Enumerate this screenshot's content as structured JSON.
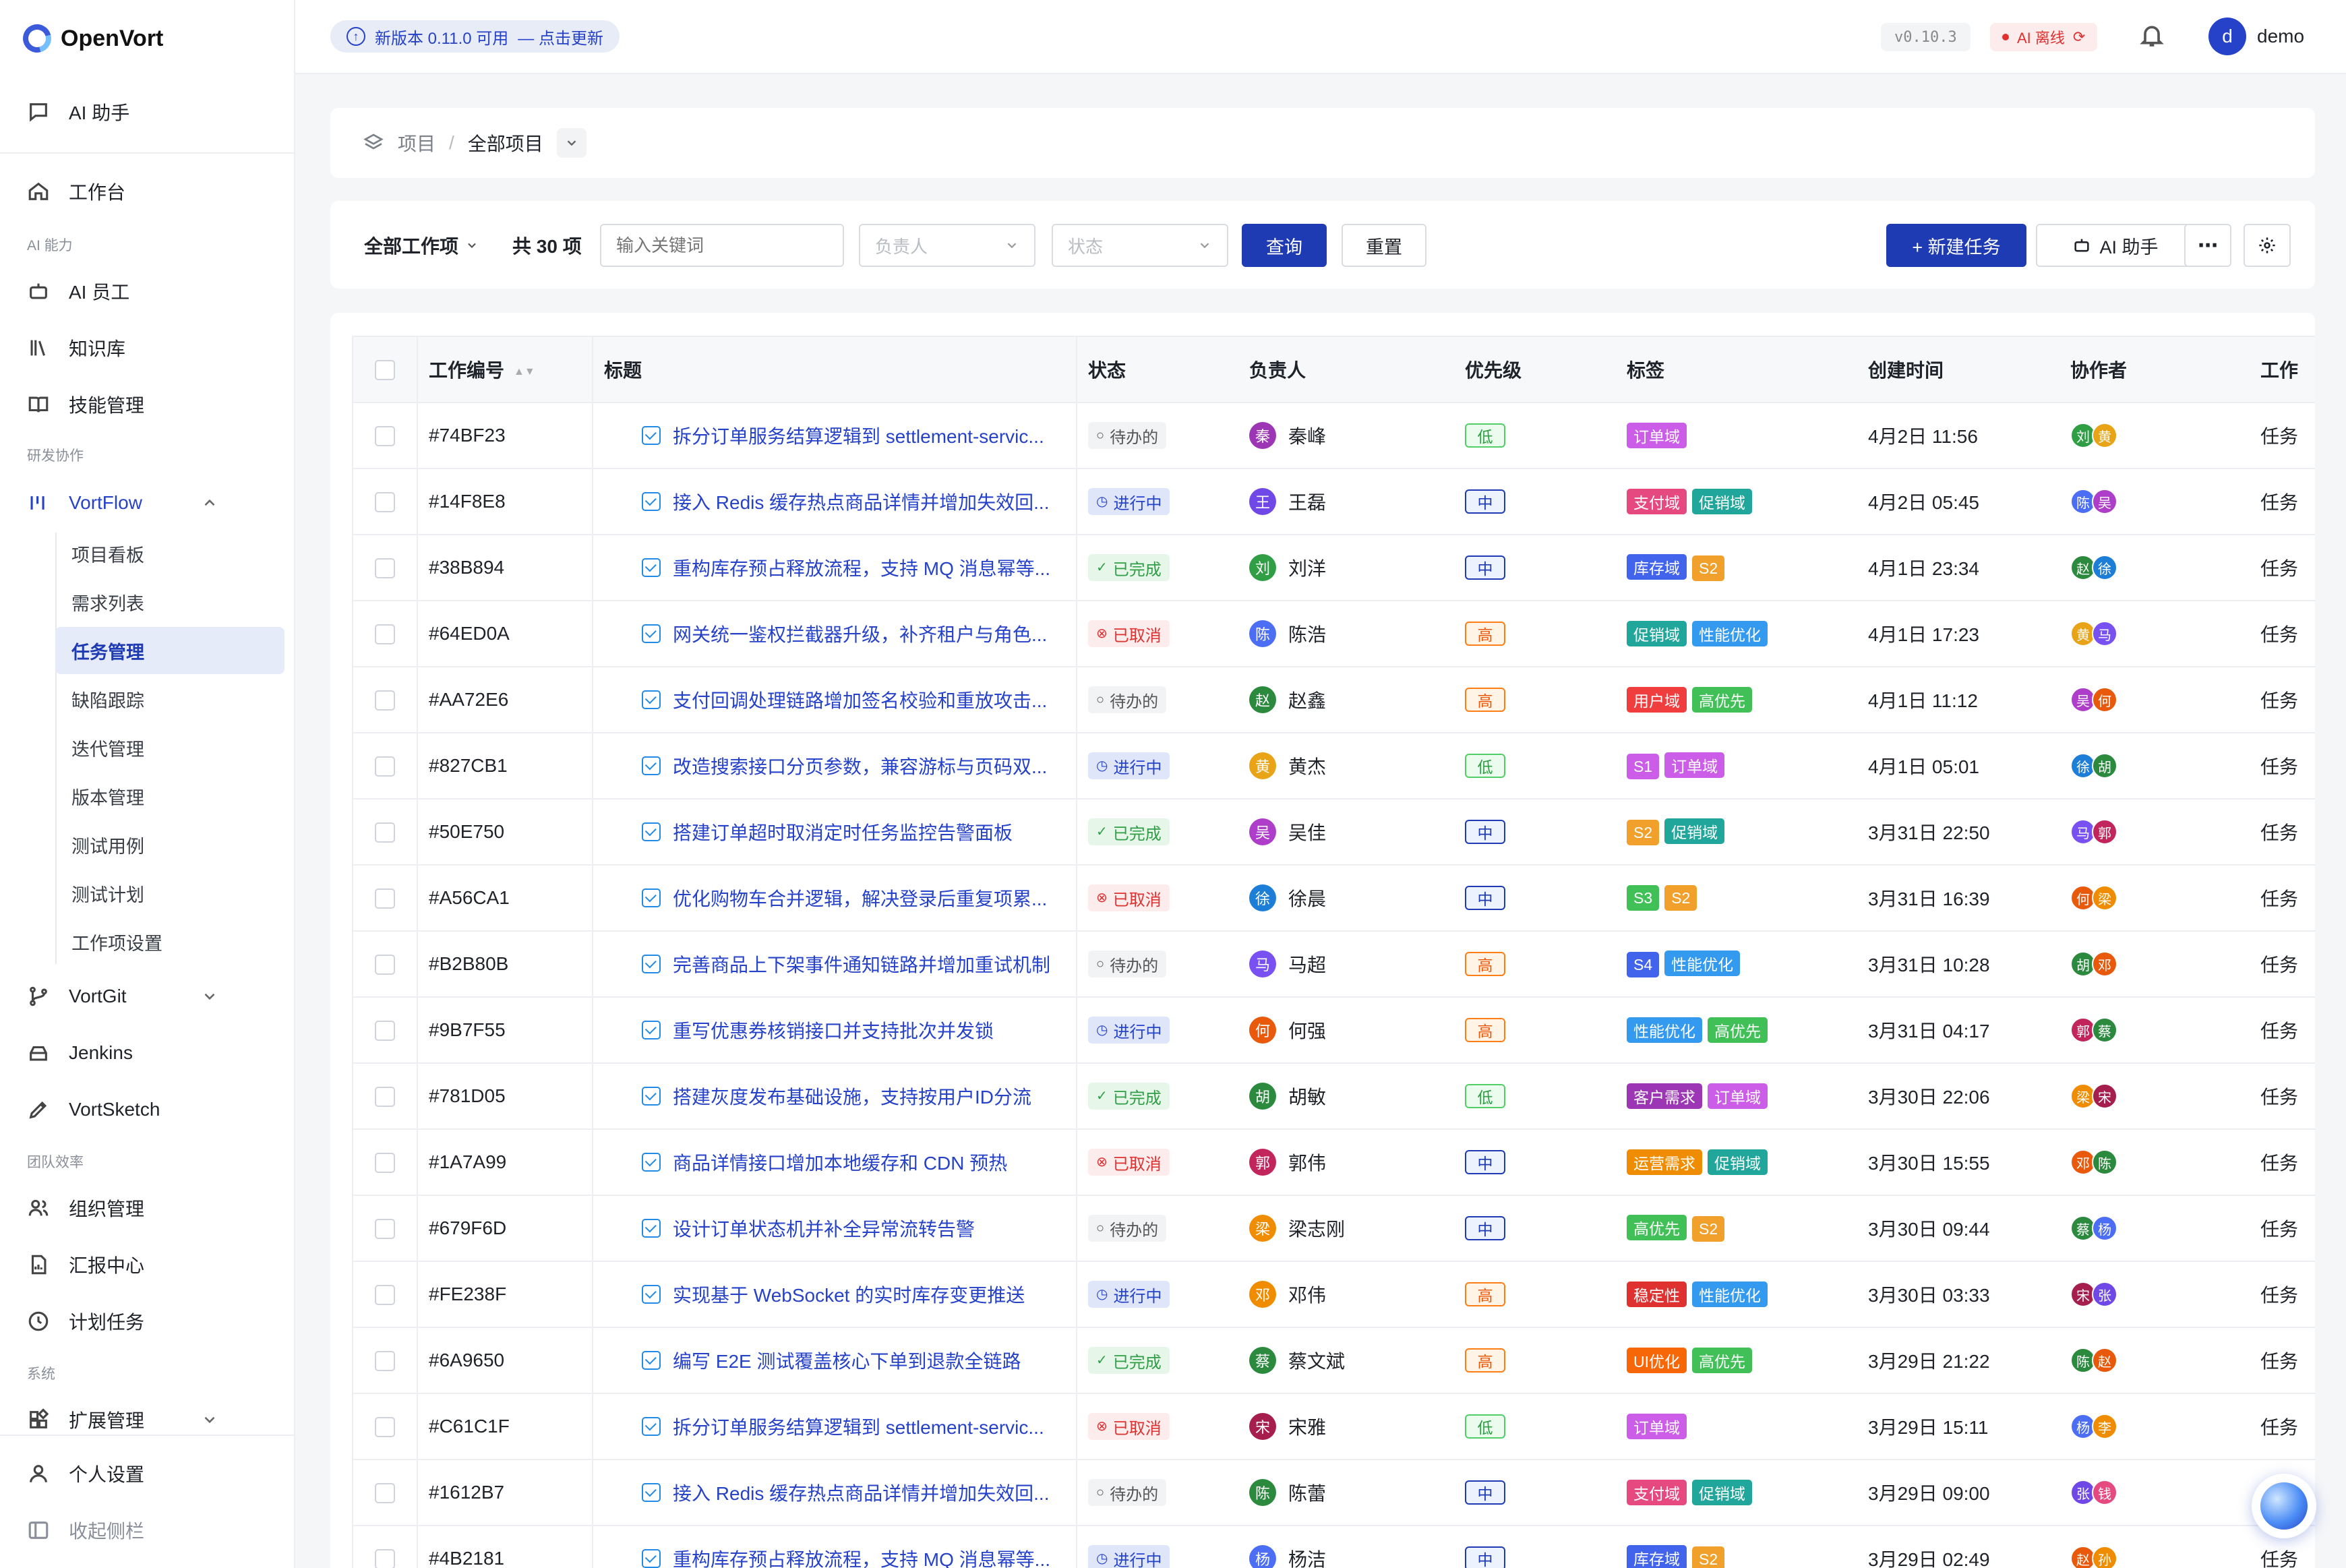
{
  "app": {
    "name": "OpenVort"
  },
  "sidebar": {
    "ai_assistant": "AI 助手",
    "workbench": "工作台",
    "section_ai": "AI 能力",
    "ai_staff": "AI 员工",
    "knowledge": "知识库",
    "skills": "技能管理",
    "section_dev": "研发协作",
    "vortflow": "VortFlow",
    "vortflow_children": [
      "项目看板",
      "需求列表",
      "任务管理",
      "缺陷跟踪",
      "迭代管理",
      "版本管理",
      "测试用例",
      "测试计划",
      "工作项设置"
    ],
    "selected_child": "任务管理",
    "vortgit": "VortGit",
    "jenkins": "Jenkins",
    "vortsketch": "VortSketch",
    "section_team": "团队效率",
    "org": "组织管理",
    "reports": "汇报中心",
    "scheduled": "计划任务",
    "section_system": "系统",
    "extensions": "扩展管理",
    "personal": "个人设置",
    "collapse": "收起侧栏"
  },
  "topbar": {
    "update_text": "新版本 0.11.0 可用",
    "update_link": "— 点击更新",
    "version": "v0.10.3",
    "ai_status": "AI 离线",
    "user_initial": "d",
    "user_name": "demo"
  },
  "breadcrumb": {
    "root": "项目",
    "current": "全部项目"
  },
  "filters": {
    "scope": "全部工作项",
    "count": "共 30 项",
    "keyword_placeholder": "输入关键词",
    "owner_placeholder": "负责人",
    "status_placeholder": "状态",
    "query": "查询",
    "reset": "重置",
    "new_task": "+ 新建任务",
    "ai_assistant": "AI 助手"
  },
  "table": {
    "columns": [
      "工作编号",
      "标题",
      "状态",
      "负责人",
      "优先级",
      "标签",
      "创建时间",
      "协作者",
      "工作"
    ],
    "more_cell": "任务",
    "rows": [
      {
        "id": "#74BF23",
        "title": "拆分订单服务结算逻辑到 settlement-servic...",
        "status": "待办的",
        "owner": "秦峰",
        "owner_initial": "秦",
        "owner_color": "#9c36b5",
        "priority": "低",
        "tags": [
          {
            "t": "订单域",
            "c": "#cc5de8"
          }
        ],
        "created": "4月2日 11:56",
        "collab": [
          {
            "i": "刘",
            "c": "#2f9e44"
          },
          {
            "i": "黄",
            "c": "#e8a317"
          }
        ]
      },
      {
        "id": "#14F8E8",
        "title": "接入 Redis 缓存热点商品详情并增加失效回...",
        "status": "进行中",
        "owner": "王磊",
        "owner_initial": "王",
        "owner_color": "#7048e8",
        "priority": "中",
        "tags": [
          {
            "t": "支付域",
            "c": "#e64980"
          },
          {
            "t": "促销域",
            "c": "#20a69a"
          }
        ],
        "created": "4月2日 05:45",
        "collab": [
          {
            "i": "陈",
            "c": "#4c6ef5"
          },
          {
            "i": "吴",
            "c": "#ae3ec9"
          }
        ]
      },
      {
        "id": "#38B894",
        "title": "重构库存预占释放流程，支持 MQ 消息幂等...",
        "status": "已完成",
        "owner": "刘洋",
        "owner_initial": "刘",
        "owner_color": "#2f9e44",
        "priority": "中",
        "tags": [
          {
            "t": "库存域",
            "c": "#4263eb"
          },
          {
            "t": "S2",
            "c": "#f0a02b"
          }
        ],
        "created": "4月1日 23:34",
        "collab": [
          {
            "i": "赵",
            "c": "#2b8a3e"
          },
          {
            "i": "徐",
            "c": "#1c7ed6"
          }
        ]
      },
      {
        "id": "#64ED0A",
        "title": "网关统一鉴权拦截器升级，补齐租户与角色...",
        "status": "已取消",
        "owner": "陈浩",
        "owner_initial": "陈",
        "owner_color": "#4c6ef5",
        "priority": "高",
        "tags": [
          {
            "t": "促销域",
            "c": "#20a69a"
          },
          {
            "t": "性能优化",
            "c": "#339af0"
          }
        ],
        "created": "4月1日 17:23",
        "collab": [
          {
            "i": "黄",
            "c": "#e8a317"
          },
          {
            "i": "马",
            "c": "#7950f2"
          }
        ]
      },
      {
        "id": "#AA72E6",
        "title": "支付回调处理链路增加签名校验和重放攻击...",
        "status": "待办的",
        "owner": "赵鑫",
        "owner_initial": "赵",
        "owner_color": "#2b8a3e",
        "priority": "高",
        "tags": [
          {
            "t": "用户域",
            "c": "#f03e3e"
          },
          {
            "t": "高优先",
            "c": "#40c057"
          }
        ],
        "created": "4月1日 11:12",
        "collab": [
          {
            "i": "吴",
            "c": "#ae3ec9"
          },
          {
            "i": "何",
            "c": "#e8590c"
          }
        ]
      },
      {
        "id": "#827CB1",
        "title": "改造搜索接口分页参数，兼容游标与页码双...",
        "status": "进行中",
        "owner": "黄杰",
        "owner_initial": "黄",
        "owner_color": "#e8a317",
        "priority": "低",
        "tags": [
          {
            "t": "S1",
            "c": "#cc5de8"
          },
          {
            "t": "订单域",
            "c": "#cc5de8"
          }
        ],
        "created": "4月1日 05:01",
        "collab": [
          {
            "i": "徐",
            "c": "#1c7ed6"
          },
          {
            "i": "胡",
            "c": "#2b8a3e"
          }
        ]
      },
      {
        "id": "#50E750",
        "title": "搭建订单超时取消定时任务监控告警面板",
        "status": "已完成",
        "owner": "吴佳",
        "owner_initial": "吴",
        "owner_color": "#ae3ec9",
        "priority": "中",
        "tags": [
          {
            "t": "S2",
            "c": "#f0a02b"
          },
          {
            "t": "促销域",
            "c": "#20a69a"
          }
        ],
        "created": "3月31日 22:50",
        "collab": [
          {
            "i": "马",
            "c": "#7950f2"
          },
          {
            "i": "郭",
            "c": "#c2255c"
          }
        ]
      },
      {
        "id": "#A56CA1",
        "title": "优化购物车合并逻辑，解决登录后重复项累...",
        "status": "已取消",
        "owner": "徐晨",
        "owner_initial": "徐",
        "owner_color": "#1c7ed6",
        "priority": "中",
        "tags": [
          {
            "t": "S3",
            "c": "#40c057"
          },
          {
            "t": "S2",
            "c": "#f0a02b"
          }
        ],
        "created": "3月31日 16:39",
        "collab": [
          {
            "i": "何",
            "c": "#e8590c"
          },
          {
            "i": "梁",
            "c": "#f08c00"
          }
        ]
      },
      {
        "id": "#B2B80B",
        "title": "完善商品上下架事件通知链路并增加重试机制",
        "status": "待办的",
        "owner": "马超",
        "owner_initial": "马",
        "owner_color": "#7950f2",
        "priority": "高",
        "tags": [
          {
            "t": "S4",
            "c": "#4263eb"
          },
          {
            "t": "性能优化",
            "c": "#339af0"
          }
        ],
        "created": "3月31日 10:28",
        "collab": [
          {
            "i": "胡",
            "c": "#2b8a3e"
          },
          {
            "i": "邓",
            "c": "#e8590c"
          }
        ]
      },
      {
        "id": "#9B7F55",
        "title": "重写优惠券核销接口并支持批次并发锁",
        "status": "进行中",
        "owner": "何强",
        "owner_initial": "何",
        "owner_color": "#e8590c",
        "priority": "高",
        "tags": [
          {
            "t": "性能优化",
            "c": "#339af0"
          },
          {
            "t": "高优先",
            "c": "#40c057"
          }
        ],
        "created": "3月31日 04:17",
        "collab": [
          {
            "i": "郭",
            "c": "#c2255c"
          },
          {
            "i": "蔡",
            "c": "#2b8a3e"
          }
        ]
      },
      {
        "id": "#781D05",
        "title": "搭建灰度发布基础设施，支持按用户ID分流",
        "status": "已完成",
        "owner": "胡敏",
        "owner_initial": "胡",
        "owner_color": "#2b8a3e",
        "priority": "低",
        "tags": [
          {
            "t": "客户需求",
            "c": "#9c36b5"
          },
          {
            "t": "订单域",
            "c": "#cc5de8"
          }
        ],
        "created": "3月30日 22:06",
        "collab": [
          {
            "i": "梁",
            "c": "#f08c00"
          },
          {
            "i": "宋",
            "c": "#a61e4d"
          }
        ]
      },
      {
        "id": "#1A7A99",
        "title": "商品详情接口增加本地缓存和 CDN 预热",
        "status": "已取消",
        "owner": "郭伟",
        "owner_initial": "郭",
        "owner_color": "#c2255c",
        "priority": "中",
        "tags": [
          {
            "t": "运营需求",
            "c": "#f08c00"
          },
          {
            "t": "促销域",
            "c": "#20a69a"
          }
        ],
        "created": "3月30日 15:55",
        "collab": [
          {
            "i": "邓",
            "c": "#e8590c"
          },
          {
            "i": "陈",
            "c": "#2b8a3e"
          }
        ]
      },
      {
        "id": "#679F6D",
        "title": "设计订单状态机并补全异常流转告警",
        "status": "待办的",
        "owner": "梁志刚",
        "owner_initial": "梁",
        "owner_color": "#f08c00",
        "priority": "中",
        "tags": [
          {
            "t": "高优先",
            "c": "#40c057"
          },
          {
            "t": "S2",
            "c": "#f0a02b"
          }
        ],
        "created": "3月30日 09:44",
        "collab": [
          {
            "i": "蔡",
            "c": "#2b8a3e"
          },
          {
            "i": "杨",
            "c": "#4c6ef5"
          }
        ]
      },
      {
        "id": "#FE238F",
        "title": "实现基于 WebSocket 的实时库存变更推送",
        "status": "进行中",
        "owner": "邓伟",
        "owner_initial": "邓",
        "owner_color": "#f08c00",
        "priority": "高",
        "tags": [
          {
            "t": "稳定性",
            "c": "#e03131"
          },
          {
            "t": "性能优化",
            "c": "#339af0"
          }
        ],
        "created": "3月30日 03:33",
        "collab": [
          {
            "i": "宋",
            "c": "#a61e4d"
          },
          {
            "i": "张",
            "c": "#7048e8"
          }
        ]
      },
      {
        "id": "#6A9650",
        "title": "编写 E2E 测试覆盖核心下单到退款全链路",
        "status": "已完成",
        "owner": "蔡文斌",
        "owner_initial": "蔡",
        "owner_color": "#2b8a3e",
        "priority": "高",
        "tags": [
          {
            "t": "UI优化",
            "c": "#f76707"
          },
          {
            "t": "高优先",
            "c": "#40c057"
          }
        ],
        "created": "3月29日 21:22",
        "collab": [
          {
            "i": "陈",
            "c": "#2b8a3e"
          },
          {
            "i": "赵",
            "c": "#e8590c"
          }
        ]
      },
      {
        "id": "#C61C1F",
        "title": "拆分订单服务结算逻辑到 settlement-servic...",
        "status": "已取消",
        "owner": "宋雅",
        "owner_initial": "宋",
        "owner_color": "#a61e4d",
        "priority": "低",
        "tags": [
          {
            "t": "订单域",
            "c": "#cc5de8"
          }
        ],
        "created": "3月29日 15:11",
        "collab": [
          {
            "i": "杨",
            "c": "#4c6ef5"
          },
          {
            "i": "李",
            "c": "#f08c00"
          }
        ]
      },
      {
        "id": "#1612B7",
        "title": "接入 Redis 缓存热点商品详情并增加失效回...",
        "status": "待办的",
        "owner": "陈蕾",
        "owner_initial": "陈",
        "owner_color": "#2b8a3e",
        "priority": "中",
        "tags": [
          {
            "t": "支付域",
            "c": "#e64980"
          },
          {
            "t": "促销域",
            "c": "#20a69a"
          }
        ],
        "created": "3月29日 09:00",
        "collab": [
          {
            "i": "张",
            "c": "#7048e8"
          },
          {
            "i": "钱",
            "c": "#e64980"
          }
        ]
      },
      {
        "id": "#4B2181",
        "title": "重构库存预占释放流程，支持 MQ 消息幂等...",
        "status": "进行中",
        "owner": "杨洁",
        "owner_initial": "杨",
        "owner_color": "#4c6ef5",
        "priority": "中",
        "tags": [
          {
            "t": "库存域",
            "c": "#4263eb"
          },
          {
            "t": "S2",
            "c": "#f0a02b"
          }
        ],
        "created": "3月29日 02:49",
        "collab": [
          {
            "i": "赵",
            "c": "#e8590c"
          },
          {
            "i": "孙",
            "c": "#f08c00"
          }
        ]
      }
    ]
  }
}
